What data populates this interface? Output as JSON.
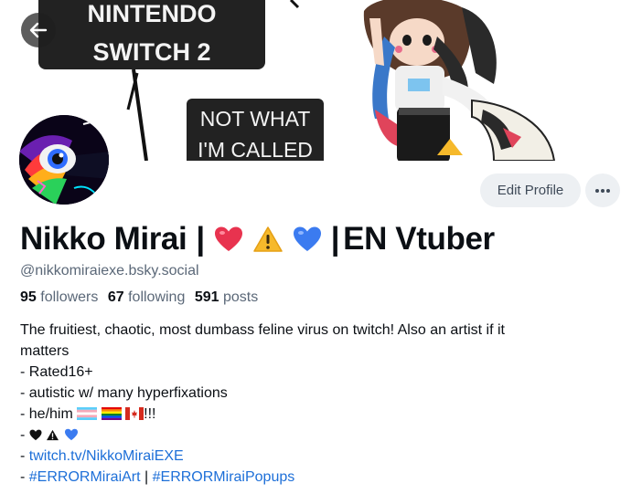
{
  "banner": {
    "sign_top_line1": "NINTENDO",
    "sign_top_line2": "SWITCH 2",
    "sign_bottom_line1": "NOT WHAT",
    "sign_bottom_line2": "I'M CALLED"
  },
  "nav": {
    "back_icon": "arrow-left-icon"
  },
  "profile": {
    "display_name_left": "Nikko Mirai",
    "display_name_right": "EN Vtuber",
    "name_separator": "|",
    "handle": "@nikkomiraiexe.bsky.social",
    "followers_count": "95",
    "followers_label": "followers",
    "following_count": "67",
    "following_label": "following",
    "posts_count": "591",
    "posts_label": "posts"
  },
  "actions": {
    "edit_label": "Edit Profile",
    "more_icon": "ellipsis-icon"
  },
  "bio": {
    "line1": "The fruitiest, chaotic, most dumbass feline virus on twitch! Also an artist if it",
    "line2": "matters",
    "line3": "- Rated16+",
    "line4": "- autistic w/ many hyperfixations",
    "line5_prefix": "- he/him",
    "line5_suffix": "!!!",
    "line6_prefix": "- ",
    "line7_prefix": "- ",
    "link_twitch": "twitch.tv/NikkoMiraiEXE",
    "line8_prefix": "- ",
    "hashtag1": "#ERRORMiraiArt",
    "hashtag_sep": " | ",
    "hashtag2": "#ERRORMiraiPopups"
  },
  "colors": {
    "link": "#1d6fd8",
    "muted": "#5b6878",
    "button_bg": "#edf0f3",
    "heart_red": "#e8334f",
    "heart_blue": "#3b7bf0",
    "warning_yellow": "#f6b92b"
  }
}
